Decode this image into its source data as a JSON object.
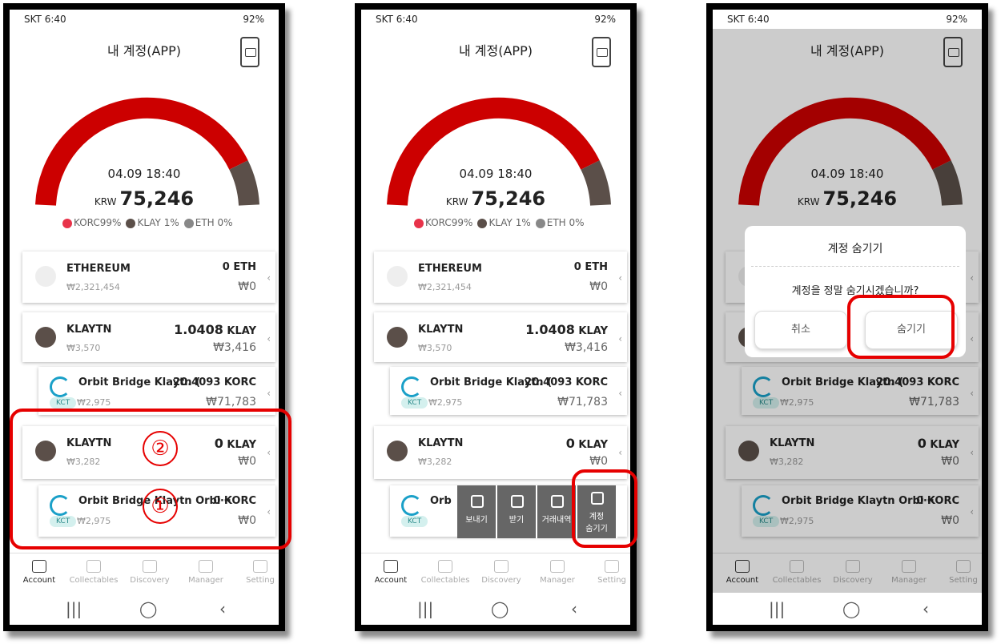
{
  "status": {
    "carrier": "SKT",
    "time": "6:40",
    "battery": "92%"
  },
  "app": {
    "title": "내 계정(APP)"
  },
  "gauge": {
    "date": "04.09 18:40",
    "currency": "KRW",
    "amount": "75,246",
    "korc_share": 0.99,
    "klay_share": 0.01,
    "eth_share": 0.0
  },
  "legend": [
    {
      "label": "KORC99%",
      "color": "#e8334a"
    },
    {
      "label": "KLAY 1%",
      "color": "#5b4f49"
    },
    {
      "label": "ETH 0%",
      "color": "#888888"
    }
  ],
  "accounts": {
    "eth": {
      "name": "ETHEREUM",
      "krw": "₩2,321,454",
      "amount": "0 ETH",
      "value": "₩0"
    },
    "klay1": {
      "name": "KLAYTN",
      "krw": "₩3,570",
      "amount_num": "1.0408",
      "amount_unit": "KLAY",
      "value": "₩3,416"
    },
    "orbit1": {
      "name": "Orbit Bridge Klaytn (",
      "tag": "KCT",
      "krw": "₩2,975",
      "amount_num": "20.4093",
      "amount_unit": "KORC",
      "value": "₩71,783"
    },
    "klay2": {
      "name": "KLAYTN",
      "krw": "₩3,282",
      "amount_num": "0",
      "amount_unit": "KLAY",
      "value": "₩0"
    },
    "orbit2": {
      "name": "Orbit Bridge Klaytn Orbi⋯",
      "name_short": "Orb",
      "tag": "KCT",
      "krw": "₩2,975",
      "amount": "0 KORC",
      "value": "₩0"
    }
  },
  "swipe_actions": [
    "보내기",
    "받기",
    "거래내역",
    "계정\n숨기기"
  ],
  "nav": [
    "Account",
    "Collectables",
    "Discovery",
    "Manager",
    "Setting"
  ],
  "annotations": {
    "circle1": "①",
    "circle2": "②"
  },
  "dialog": {
    "title": "계정 숨기기",
    "message": "계정을 정말 숨기시겠습니까?",
    "cancel": "취소",
    "confirm": "숨기기"
  },
  "colors": {
    "gauge_red": "#cc0000",
    "gauge_brown": "#5b4f49",
    "highlight": "#e60000"
  }
}
